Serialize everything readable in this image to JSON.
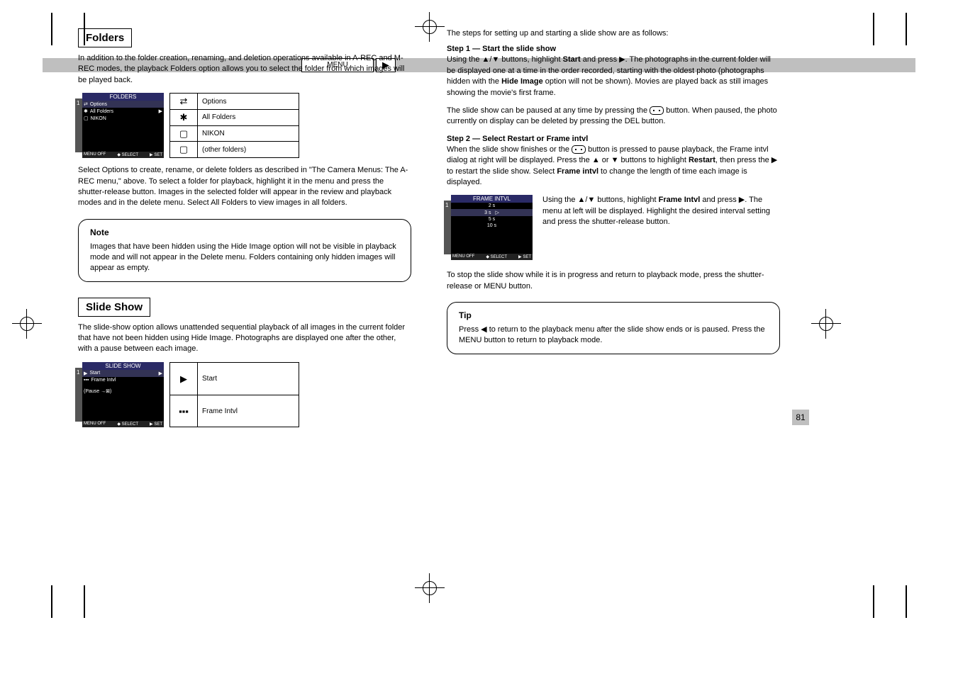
{
  "band": {
    "menu_label": "MENU",
    "play_glyph": "▶"
  },
  "folders": {
    "heading": "Folders",
    "intro": "In addition to the folder creation, renaming, and dele­tion operations available in A-REC and M-REC modes, the playback Folders option allows you to select the folder from which images will be played back.",
    "lcd": {
      "title": "FOLDERS",
      "items": [
        "Options",
        "All Folders",
        "NIKON"
      ],
      "bottom": [
        "MENU OFF",
        "◆ SELECT",
        "▶ SET"
      ],
      "side": "1"
    },
    "opt_table": [
      {
        "ico": "⇄",
        "txt": "Options"
      },
      {
        "ico": "✱",
        "txt": "All Folders"
      },
      {
        "ico": "▢",
        "txt": "NIKON"
      },
      {
        "ico": "▢",
        "txt": "(other folders)"
      }
    ],
    "para1": "Select Options to create, rename, or delete folders as described in \"The Camera Menus: The A-REC menu,\" above. To select a folder for playback, highlight it in the menu and press the shutter-release button. Images in the selected folder will appear in the review and play­back modes and in the delete menu. Select All Folders to view images in all folders.",
    "note": {
      "hd": "Note",
      "body": "Images that have been hidden using the Hide Image option will not be visible in playback mode and will not appear in the Delete menu. Folders containing only hidden images will appear as empty."
    }
  },
  "slideshow": {
    "heading": "Slide Show",
    "intro": "The slide-show option allows unattended sequential playback of all images in the current folder that have not been hidden using Hide Image. Photographs are displayed one after the other, with a pause between each image.",
    "lcd": {
      "title": "SLIDE SHOW",
      "items": [
        "Start",
        "Frame Intvl",
        "(Pause →⊠)"
      ],
      "bottom": [
        "MENU OFF",
        "◆ SELECT",
        "▶ SET"
      ],
      "side": "1"
    },
    "opt_table": [
      {
        "ico": "▶",
        "txt": "Start"
      },
      {
        "ico": "▪▪▪",
        "txt": "Frame Intvl"
      }
    ]
  },
  "right": {
    "start_para1": "The steps for setting up and starting a slide show are as follows:",
    "step1": {
      "label": "Step 1 — Start the slide show",
      "body": "Using the ▲/▼ buttons, highlight Start and press ▶. The photographs in the current folder will be displayed one at a time in the order recorded, starting with the oldest photo (photographs hidden with the Hide Image option will not be shown). Movies are played back as still images showing the movie's first frame."
    },
    "pause": "The slide show can be paused at any time by pressing the 📷 button. When paused, the photo currently on display can be deleted by pressing the DEL button.",
    "step2": {
      "label": "Step 2 — Select Restart or Frame intvl",
      "body": "When the slide show finishes or the 📷 button is pressed to pause playback, the Frame intvl dialog at right will be displayed. Press the ▲ or ▼ buttons to highlight Restart, then press the ▶ to restart the slide show. Select Frame intvl to change the length of time each image is displayed.",
      "subbody": "Using the ▲/▼ buttons, highlight Frame Intvl and press ▶. The menu at left will be displayed. Highlight the desired interval setting and press the shutter-release button."
    },
    "frame_lcd": {
      "title": "FRAME INTVL",
      "rows": [
        "2 s",
        "3 s",
        "5 s",
        "10 s"
      ],
      "sel_index": 1,
      "bottom": [
        "MENU OFF",
        "◆ SELECT",
        "▶ SET"
      ],
      "side": "1"
    },
    "under_para": "To stop the slide show while it is in progress and return to playback mode, press the shutter-release or MENU button.",
    "note": {
      "hd": "Tip",
      "body": "Press ◀ to return to the playback menu after the slide show ends or is paused. Press the MENU button to return to playback mode."
    }
  },
  "page_num": "81"
}
